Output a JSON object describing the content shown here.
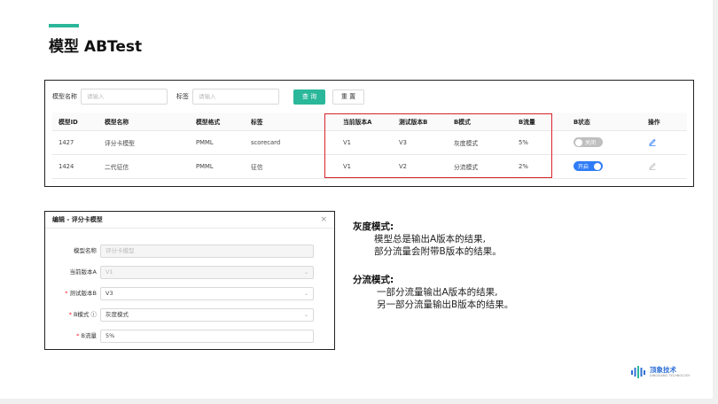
{
  "page": {
    "title": "模型 ABTest"
  },
  "filters": {
    "name_label": "模型名称",
    "name_placeholder": "请输入",
    "tag_label": "标签",
    "tag_placeholder": "请输入",
    "search_button": "查 询",
    "reset_button": "重 置"
  },
  "table": {
    "headers": [
      "模型ID",
      "模型名称",
      "模型格式",
      "标签",
      "当前版本A",
      "测试版本B",
      "B模式",
      "B流量",
      "B状态",
      "操作"
    ],
    "rows": [
      {
        "id": "1427",
        "name": "评分卡模型",
        "format": "PMML",
        "tag": "scorecard",
        "version_a": "V1",
        "version_b": "V3",
        "mode": "灰度模式",
        "traffic": "5%",
        "status_label": "关闭",
        "status_on": false
      },
      {
        "id": "1424",
        "name": "二代征信",
        "format": "PMML",
        "tag": "征信",
        "version_a": "V1",
        "version_b": "V2",
        "mode": "分流模式",
        "traffic": "2%",
        "status_label": "开启",
        "status_on": true
      }
    ]
  },
  "dialog": {
    "title": "编辑 - 评分卡模型",
    "close_glyph": "×",
    "fields": [
      {
        "label": "模型名称",
        "value": "评分卡模型",
        "required": false
      },
      {
        "label": "当前版本A",
        "value": "V1",
        "required": false
      },
      {
        "label": "测试版本B",
        "value": "V3",
        "required": true
      },
      {
        "label": "B模式",
        "value": "灰度模式",
        "required": true
      },
      {
        "label": "B流量",
        "value": "5%",
        "required": true
      }
    ]
  },
  "explanations": {
    "gray_title": "灰度模式:",
    "gray_line1": "模型总是输出A版本的结果,",
    "gray_line2": "部分流量会附带B版本的结果。",
    "split_title": "分流模式:",
    "split_line1": "一部分流量输出A版本的结果,",
    "split_line2": "另一部分流量输出B版本的结果。"
  },
  "logo": {
    "text": "顶象技术",
    "sub": "DINGXIANG TECHNOLOGY"
  },
  "colors": {
    "accent": "#2bb79a",
    "toggle_on": "#2f7cf6",
    "highlight": "#d9242b"
  }
}
